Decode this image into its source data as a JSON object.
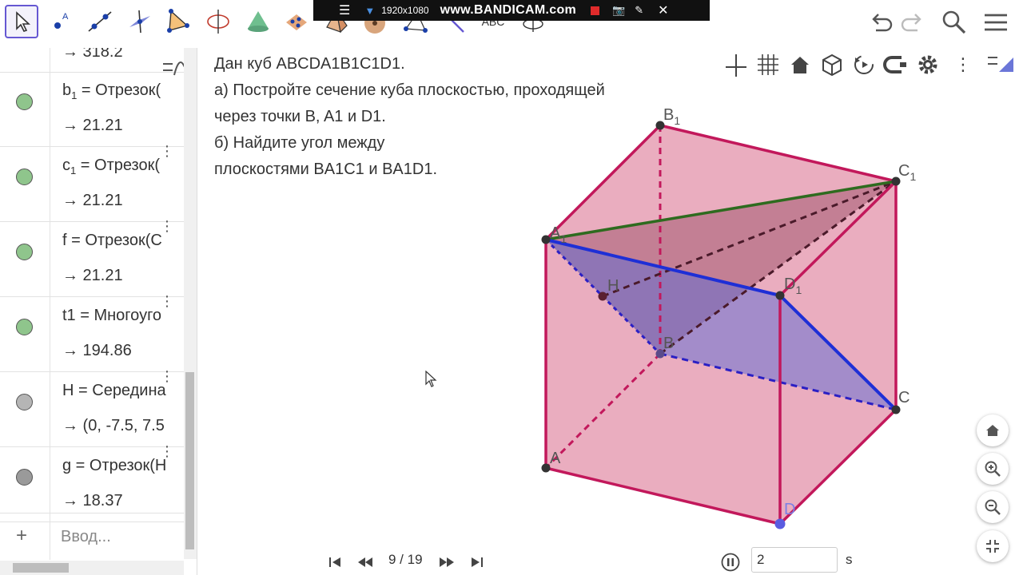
{
  "recorder": {
    "resolution": "1920x1080",
    "brand": "www.BANDICAM.com"
  },
  "toolbar": {
    "tools": [
      "move-tool",
      "point-tool",
      "line-tool",
      "perpendicular-line-tool",
      "plane-tool",
      "pyramid-tool",
      "circle-axis-tool",
      "cone-tool",
      "net-tool",
      "polyhedron-tool",
      "sphere-tool",
      "angle-tool",
      "reflect-tool",
      "text-tool",
      "rotate-view-tool"
    ],
    "text_tool_label": "ABC"
  },
  "algebra": {
    "top_value": "→ 318.2",
    "items": [
      {
        "def_name": "b",
        "def_sub": "1",
        "def_rest": " = Отрезок(",
        "value": "→ 21.21",
        "color": "#8fc58c"
      },
      {
        "def_name": "c",
        "def_sub": "1",
        "def_rest": " = Отрезок(",
        "value": "→ 21.21",
        "color": "#8fc58c"
      },
      {
        "def_name": "f",
        "def_sub": "",
        "def_rest": " = Отрезок(C",
        "value": "→ 21.21",
        "color": "#8fc58c"
      },
      {
        "def_name": "t1",
        "def_sub": "",
        "def_rest": " = Многоуго",
        "value": "→ 194.86",
        "color": "#8fc58c"
      },
      {
        "def_name": "H",
        "def_sub": "",
        "def_rest": " = Середина",
        "value": "→ (0, -7.5, 7.5",
        "color": "#b5b5b5"
      },
      {
        "def_name": "g",
        "def_sub": "",
        "def_rest": " = Отрезок(H",
        "value": "→ 18.37",
        "color": "#9a9a9a"
      }
    ],
    "input_placeholder": "Ввод..."
  },
  "problem": {
    "lines": [
      "Дан куб ABCDA1B1C1D1.",
      "а) Постройте сечение куба плоскостью, проходящей",
      "через точки B, A1 и D1.",
      "б) Найдите угол между",
      "плоскостями BA1C1 и BA1D1."
    ]
  },
  "points": {
    "B1": "B",
    "C1": "C",
    "A1": "A",
    "D1": "D",
    "H": "H",
    "B": "B",
    "C": "C",
    "A": "A",
    "D": "D",
    "sub": "1"
  },
  "navigation": {
    "page": "9 / 19"
  },
  "animation": {
    "value": "2",
    "unit": "s"
  },
  "colors": {
    "accent": "#6557d2",
    "cube_edge": "#c2185b",
    "cube_face": "#d96a8a",
    "section_edge": "#1e2fd6",
    "green_edge": "#2e6b1f"
  }
}
